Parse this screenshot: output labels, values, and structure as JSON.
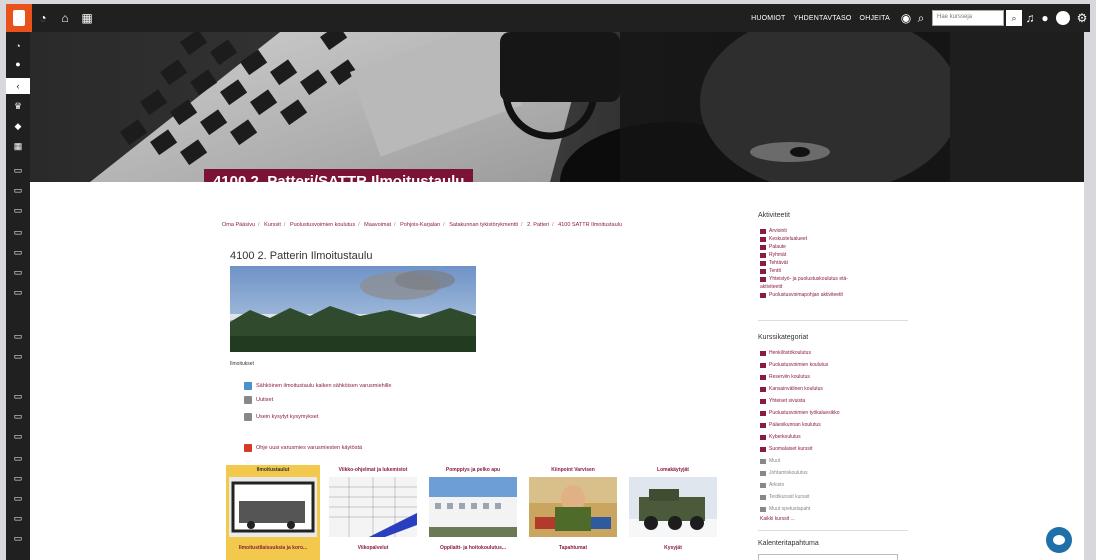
{
  "navbar": {
    "links": [
      "HUOMIOT",
      "YHDENTAVTASO",
      "OHJEITA"
    ],
    "search_placeholder": "Hae kursseja"
  },
  "course": {
    "title": "4100 2. Patteri/SATTR Ilmoitustaulu"
  },
  "breadcrumb": [
    "Oma Pääsivu",
    "Kurssit",
    "Puolustusvoimien koulutus",
    "Maavoimat",
    "Pohjois-Karjalan",
    "Satakunnan tykistörykmentti",
    "2. Patteri",
    "4100 SATTR Ilmoitustaulu"
  ],
  "section": {
    "title": "4100 2. Patterin Ilmoitustaulu",
    "label": "Ilmoitukset"
  },
  "activities": [
    "Sähköinen ilmoitustaulu kaiken sähköisen varusmiehille",
    "Uutiset",
    "Usein kysytyt kysymykset",
    "Ohje uusi varusmies varusmiesten käytöstä"
  ],
  "tiles": [
    {
      "title": "Ilmoitustaulut",
      "subtitle": "Ilmoitustilaisuuksia ja koro..."
    },
    {
      "title": "Viikko-ohjelmat ja lukemistot",
      "subtitle": "Viikopalvelut"
    },
    {
      "title": "Pomppiys ja pelko apu",
      "subtitle": "Oppilaitt- ja hoitokoulutus..."
    },
    {
      "title": "Kiinpoint Varvisen",
      "subtitle": "Tapahtumat"
    },
    {
      "title": "Lomakäytyjät",
      "subtitle": "Kysyjät"
    }
  ],
  "right": {
    "navigation_title": "Aktiviteetit",
    "navigation_items": [
      "Arviointi",
      "Keskustelualueet",
      "Palaute",
      "Ryhmät",
      "Tehtävät",
      "Tentit",
      "Yhteistyö- ja puolustuskoulutus etä-",
      "aktiviteetit",
      "Puolustusvoimapohjan aktiviteetit"
    ],
    "categories_title": "Kurssikategoriat",
    "categories": [
      "Henkilöstökoulutus",
      "Puolustusvoimien koulutus",
      "Reserviin koulutus",
      "Kansainvälinen koulutus",
      "Yhteiset sivuista",
      "Puolustusvoimien työkaluesikko",
      "Pääesikunnan koulutus",
      "Kyberkoulutus",
      "Suomalaiset kurssit"
    ],
    "categories_muted": [
      "Muut",
      "Johtamiskoulutus",
      "Arkisto",
      "Testikurssit kurssit",
      "Muut opetustapaht"
    ],
    "all_courses": "Kaikki kurssit ...",
    "calendar_title": "Kalenteritapahtuma"
  },
  "colors": {
    "brand": "#7b1434",
    "link": "#8a1d3f",
    "navbar": "#202020",
    "logo": "#e8521b",
    "chat": "#1f6fa8"
  }
}
